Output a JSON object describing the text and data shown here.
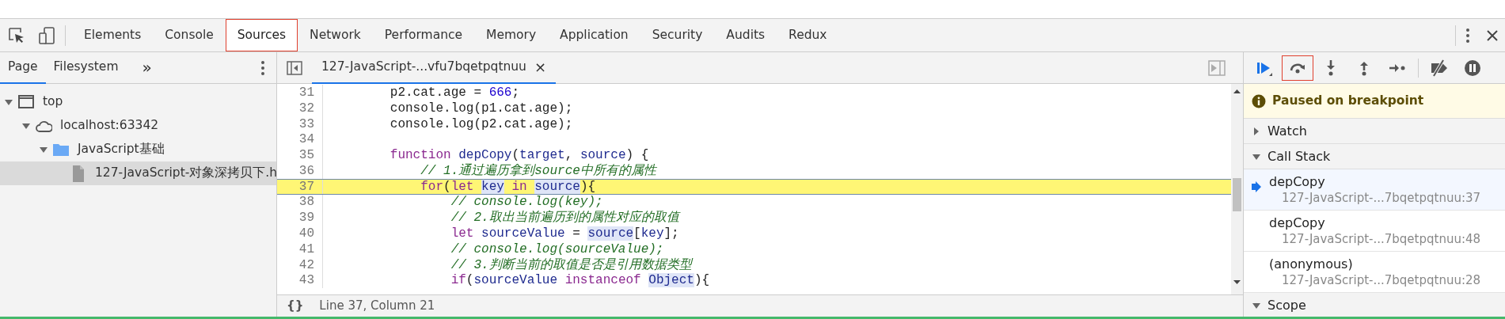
{
  "toolbar": {
    "tabs": [
      {
        "label": "Elements",
        "selected": false,
        "annotated": false
      },
      {
        "label": "Console",
        "selected": false,
        "annotated": false
      },
      {
        "label": "Sources",
        "selected": true,
        "annotated": true
      },
      {
        "label": "Network",
        "selected": false,
        "annotated": false
      },
      {
        "label": "Performance",
        "selected": false,
        "annotated": false
      },
      {
        "label": "Memory",
        "selected": false,
        "annotated": false
      },
      {
        "label": "Application",
        "selected": false,
        "annotated": false
      },
      {
        "label": "Security",
        "selected": false,
        "annotated": false
      },
      {
        "label": "Audits",
        "selected": false,
        "annotated": false
      },
      {
        "label": "Redux",
        "selected": false,
        "annotated": false
      }
    ]
  },
  "navigator": {
    "tabs": [
      {
        "label": "Page",
        "selected": true
      },
      {
        "label": "Filesystem",
        "selected": false
      }
    ],
    "more": "»",
    "tree": [
      {
        "label": "top",
        "kind": "frame",
        "expanded": true,
        "selected": false,
        "children": [
          {
            "label": "localhost:63342",
            "kind": "domain",
            "expanded": true,
            "selected": false,
            "children": [
              {
                "label": "JavaScript基础",
                "kind": "folder",
                "expanded": true,
                "selected": false,
                "children": [
                  {
                    "label": "127-JavaScript-对象深拷贝下.h",
                    "kind": "file",
                    "selected": true
                  }
                ]
              }
            ]
          }
        ]
      }
    ]
  },
  "editor": {
    "file_tab": {
      "label": "127-JavaScript-...vfu7bqetpqtnuu",
      "close": "×",
      "selected": true
    },
    "lines": [
      {
        "number": "31",
        "current": false,
        "tokens": [
          {
            "kind": "plain",
            "text": "        p2.cat.age = "
          },
          {
            "kind": "number",
            "text": "666"
          },
          {
            "kind": "plain",
            "text": ";"
          }
        ]
      },
      {
        "number": "32",
        "current": false,
        "tokens": [
          {
            "kind": "plain",
            "text": "        console.log(p1.cat.age);"
          }
        ]
      },
      {
        "number": "33",
        "current": false,
        "tokens": [
          {
            "kind": "plain",
            "text": "        console.log(p2.cat.age);"
          }
        ]
      },
      {
        "number": "34",
        "current": false
      },
      {
        "number": "35",
        "current": false,
        "tokens": [
          {
            "kind": "keyword",
            "text": "        function "
          },
          {
            "kind": "def",
            "text": "depCopy"
          },
          {
            "kind": "plain",
            "text": "("
          },
          {
            "kind": "def",
            "text": "target"
          },
          {
            "kind": "plain",
            "text": ", "
          },
          {
            "kind": "def",
            "text": "source"
          },
          {
            "kind": "plain",
            "text": ") {"
          }
        ]
      },
      {
        "number": "36",
        "current": false,
        "tokens": [
          {
            "kind": "comment",
            "text": "            // 1.通过遍历拿到source中所有的属性"
          }
        ]
      },
      {
        "number": "37",
        "current": true,
        "tokens": [
          {
            "kind": "keyword",
            "text": "            for"
          },
          {
            "kind": "plain",
            "text": "("
          },
          {
            "kind": "keyword",
            "text": "let "
          },
          {
            "kind": "match",
            "text": "key"
          },
          {
            "kind": "keyword",
            "text": " in "
          },
          {
            "kind": "match",
            "text": "source"
          },
          {
            "kind": "plain",
            "text": "){"
          }
        ]
      },
      {
        "number": "38",
        "current": false,
        "tokens": [
          {
            "kind": "comment",
            "text": "                // console.log(key);"
          }
        ]
      },
      {
        "number": "39",
        "current": false,
        "tokens": [
          {
            "kind": "comment",
            "text": "                // 2.取出当前遍历到的属性对应的取值"
          }
        ]
      },
      {
        "number": "40",
        "current": false,
        "tokens": [
          {
            "kind": "keyword",
            "text": "                let "
          },
          {
            "kind": "def",
            "text": "sourceValue"
          },
          {
            "kind": "plain",
            "text": " = "
          },
          {
            "kind": "match",
            "text": "source"
          },
          {
            "kind": "plain",
            "text": "["
          },
          {
            "kind": "def",
            "text": "key"
          },
          {
            "kind": "plain",
            "text": "];"
          }
        ]
      },
      {
        "number": "41",
        "current": false,
        "tokens": [
          {
            "kind": "comment",
            "text": "                // console.log(sourceValue);"
          }
        ]
      },
      {
        "number": "42",
        "current": false,
        "tokens": [
          {
            "kind": "comment",
            "text": "                // 3.判断当前的取值是否是引用数据类型"
          }
        ]
      },
      {
        "number": "43",
        "current": false,
        "tokens": [
          {
            "kind": "keyword",
            "text": "                if"
          },
          {
            "kind": "plain",
            "text": "("
          },
          {
            "kind": "def",
            "text": "sourceValue"
          },
          {
            "kind": "keyword",
            "text": " instanceof "
          },
          {
            "kind": "match",
            "text": "Object"
          },
          {
            "kind": "plain",
            "text": "){"
          }
        ]
      }
    ],
    "status": {
      "format_button": "{}",
      "position": "Line 37, Column 21"
    }
  },
  "debugger": {
    "buttons": [
      {
        "kind": "resume",
        "annotated": false
      },
      {
        "kind": "step-over",
        "annotated": true
      },
      {
        "kind": "step-into",
        "annotated": false
      },
      {
        "kind": "step-out",
        "annotated": false
      },
      {
        "kind": "step",
        "annotated": false
      },
      {
        "kind": "deactivate",
        "annotated": false
      },
      {
        "kind": "pause",
        "annotated": false
      }
    ],
    "banner": "Paused on breakpoint",
    "sections": [
      {
        "title": "Watch",
        "expanded": false
      },
      {
        "title": "Call Stack",
        "expanded": true,
        "frames": [
          {
            "function": "depCopy",
            "location": "127-JavaScript-...7bqetpqtnuu:37",
            "selected": true
          },
          {
            "function": "depCopy",
            "location": "127-JavaScript-...7bqetpqtnuu:48",
            "selected": false
          },
          {
            "function": "(anonymous)",
            "location": "127-JavaScript-...7bqetpqtnuu:28",
            "selected": false
          }
        ]
      },
      {
        "title": "Scope",
        "expanded": true
      }
    ]
  }
}
